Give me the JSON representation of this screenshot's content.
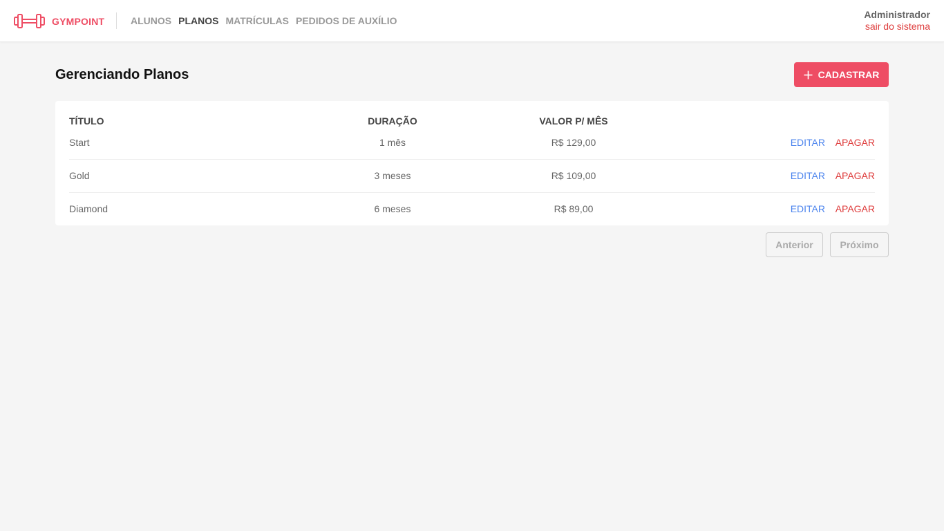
{
  "header": {
    "brand": "GYMPOINT",
    "nav": [
      {
        "label": "ALUNOS",
        "active": false
      },
      {
        "label": "PLANOS",
        "active": true
      },
      {
        "label": "MATRÍCULAS",
        "active": false
      },
      {
        "label": "PEDIDOS DE AUXÍLIO",
        "active": false
      }
    ],
    "user": {
      "name": "Administrador",
      "logout": "sair do sistema"
    }
  },
  "page": {
    "title": "Gerenciando Planos",
    "add_button": "CADASTRAR"
  },
  "table": {
    "columns": [
      "TÍTULO",
      "DURAÇÃO",
      "VALOR P/ MÊS"
    ],
    "rows": [
      {
        "title": "Start",
        "duration": "1 mês",
        "price": "R$ 129,00",
        "edit": "EDITAR",
        "delete": "APAGAR"
      },
      {
        "title": "Gold",
        "duration": "3 meses",
        "price": "R$ 109,00",
        "edit": "EDITAR",
        "delete": "APAGAR"
      },
      {
        "title": "Diamond",
        "duration": "6 meses",
        "price": "R$ 89,00",
        "edit": "EDITAR",
        "delete": "APAGAR"
      }
    ]
  },
  "pagination": {
    "prev": "Anterior",
    "next": "Próximo",
    "prev_disabled": true,
    "next_disabled": true
  },
  "colors": {
    "accent": "#ee4d64",
    "edit_link": "#4d85ee",
    "delete_link": "#de3b3b",
    "background": "#f5f5f5"
  },
  "icons": {
    "brand": "dumbbell-icon",
    "add": "plus-icon"
  }
}
